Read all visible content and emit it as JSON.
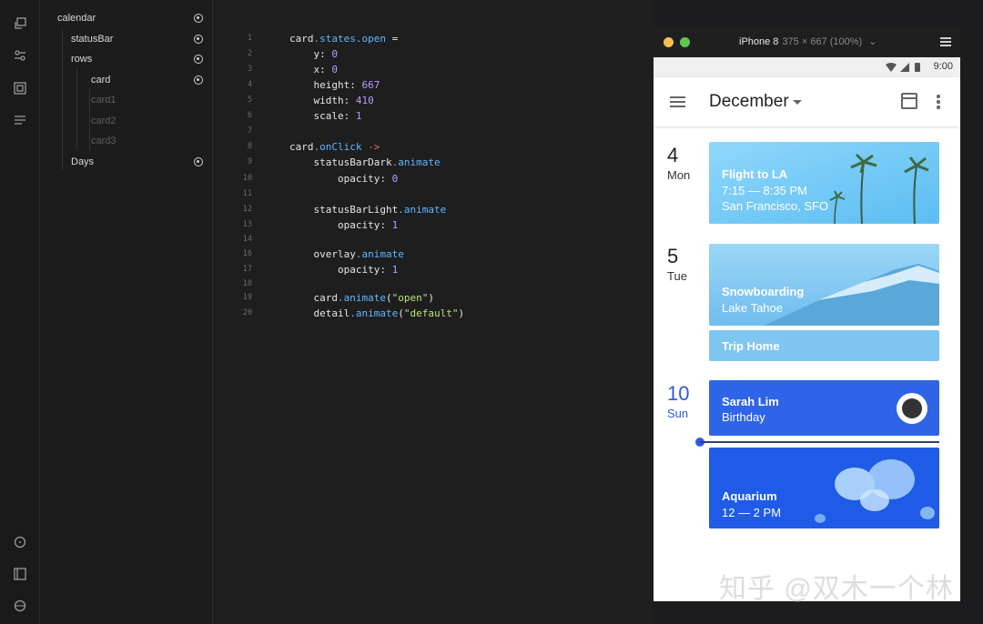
{
  "toolbar": {
    "icons": [
      "layers-copy-icon",
      "sliders-icon",
      "frame-icon",
      "text-lines-icon",
      "info-icon",
      "panel-icon",
      "help-icon"
    ]
  },
  "layers": [
    {
      "label": "calendar",
      "dim": false,
      "dot": true
    },
    {
      "label": "statusBar",
      "dim": false,
      "dot": true
    },
    {
      "label": "rows",
      "dim": false,
      "dot": true
    },
    {
      "label": "card",
      "dim": false,
      "dot": true
    },
    {
      "label": "card1",
      "dim": true,
      "dot": false
    },
    {
      "label": "card2",
      "dim": true,
      "dot": false
    },
    {
      "label": "card3",
      "dim": true,
      "dot": false
    },
    {
      "label": "Days",
      "dim": false,
      "dot": true
    }
  ],
  "code": [
    {
      "n": "1",
      "t": [
        [
          "card",
          ""
        ],
        [
          ".states.open",
          "prop"
        ],
        [
          " =",
          ""
        ]
      ]
    },
    {
      "n": "2",
      "t": [
        [
          "    y: ",
          ""
        ],
        [
          "0",
          "num"
        ]
      ]
    },
    {
      "n": "3",
      "t": [
        [
          "    x: ",
          ""
        ],
        [
          "0",
          "num"
        ]
      ]
    },
    {
      "n": "4",
      "t": [
        [
          "    height: ",
          ""
        ],
        [
          "667",
          "num"
        ]
      ]
    },
    {
      "n": "5",
      "t": [
        [
          "    width: ",
          ""
        ],
        [
          "410",
          "num"
        ]
      ]
    },
    {
      "n": "6",
      "t": [
        [
          "    scale: ",
          ""
        ],
        [
          "1",
          "num"
        ]
      ]
    },
    {
      "n": "7",
      "t": []
    },
    {
      "n": "8",
      "t": [
        [
          "card",
          ""
        ],
        [
          ".onClick",
          "prop"
        ],
        [
          " ",
          ""
        ],
        [
          "->",
          "op"
        ]
      ]
    },
    {
      "n": "9",
      "t": [
        [
          "    statusBarDark",
          ""
        ],
        [
          ".animate",
          "prop"
        ]
      ]
    },
    {
      "n": "10",
      "t": [
        [
          "        opacity: ",
          ""
        ],
        [
          "0",
          "num"
        ]
      ]
    },
    {
      "n": "11",
      "t": []
    },
    {
      "n": "12",
      "t": [
        [
          "    statusBarLight",
          ""
        ],
        [
          ".animate",
          "prop"
        ]
      ]
    },
    {
      "n": "13",
      "t": [
        [
          "        opacity: ",
          ""
        ],
        [
          "1",
          "num"
        ]
      ]
    },
    {
      "n": "14",
      "t": []
    },
    {
      "n": "16",
      "t": [
        [
          "    overlay",
          ""
        ],
        [
          ".animate",
          "prop"
        ]
      ]
    },
    {
      "n": "17",
      "t": [
        [
          "        opacity: ",
          ""
        ],
        [
          "1",
          "num"
        ]
      ]
    },
    {
      "n": "18",
      "t": []
    },
    {
      "n": "19",
      "t": [
        [
          "    card",
          ""
        ],
        [
          ".animate",
          "prop"
        ],
        [
          "(",
          ""
        ],
        [
          "\"open\"",
          "str"
        ],
        [
          ")",
          ""
        ]
      ]
    },
    {
      "n": "20",
      "t": [
        [
          "    detail",
          ""
        ],
        [
          ".animate",
          "prop"
        ],
        [
          "(",
          ""
        ],
        [
          "\"default\"",
          "str"
        ],
        [
          ")",
          ""
        ]
      ]
    }
  ],
  "device": {
    "name": "iPhone 8",
    "size": "375 × 667 (100%)",
    "time": "9:00",
    "month": "December"
  },
  "days": [
    {
      "d": "4",
      "w": "Mon"
    },
    {
      "d": "5",
      "w": "Tue"
    },
    {
      "d": "10",
      "w": "Sun"
    }
  ],
  "cards": [
    {
      "title": "Flight to LA",
      "sub": "7:15 — 8:35 PM",
      "sub2": "San Francisco, SFO",
      "color": "#6ec6f5"
    },
    {
      "title": "Snowboarding",
      "sub": "Lake Tahoe",
      "color": "#7ac2ee"
    },
    {
      "title": "Trip Home",
      "color": "#7cc4f0"
    },
    {
      "title": "Sarah Lim",
      "sub": "Birthday",
      "color": "#2e64e8"
    },
    {
      "title": "Aquarium",
      "sub": "12 — 2 PM",
      "color": "#1f5be6"
    }
  ],
  "watermark": "知乎 @双木一个林"
}
